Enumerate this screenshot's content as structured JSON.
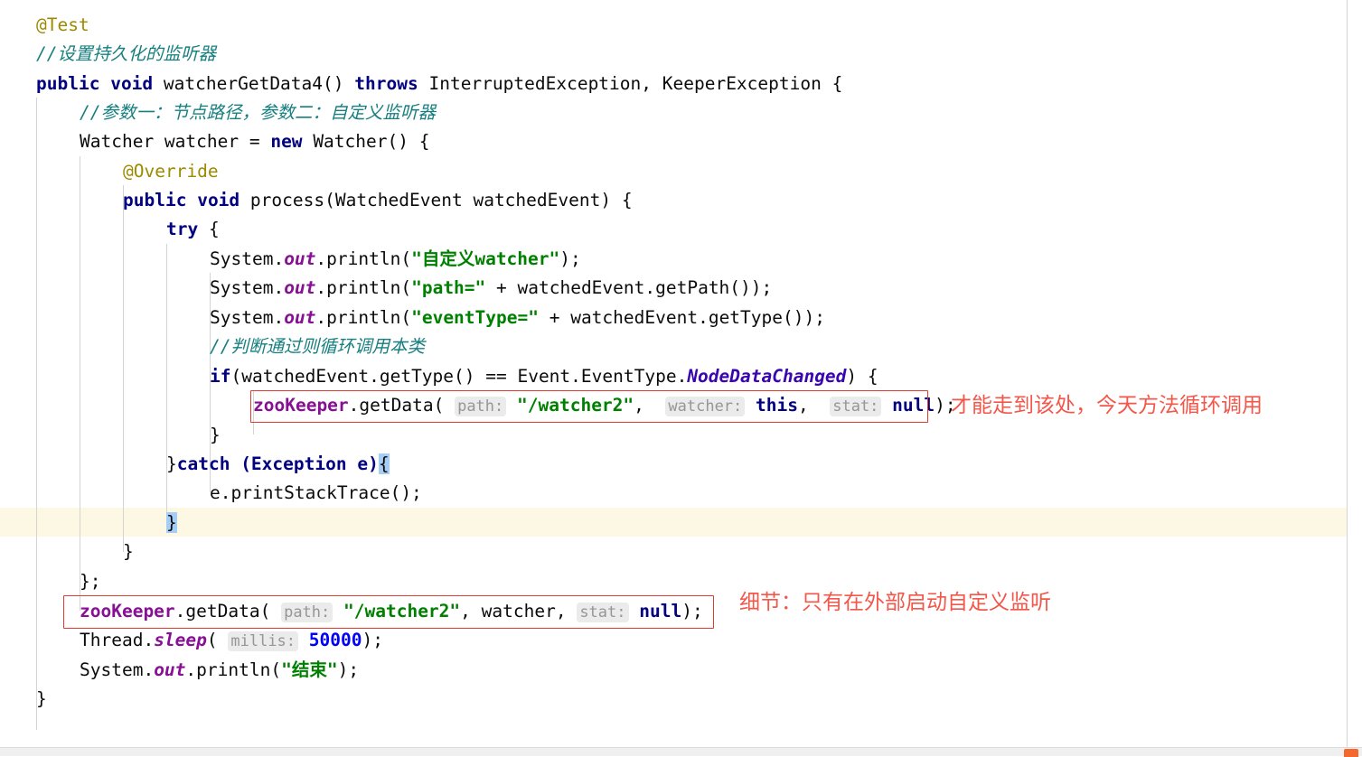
{
  "editor": {
    "language": "Java",
    "font_size_px": 19.5,
    "line_height_px": 32,
    "colors": {
      "background": "#ffffff",
      "text": "#0b0b0b",
      "keyword": "#000080",
      "annotation": "#9e8a00",
      "comment": "#177f7f",
      "string": "#008000",
      "number": "#0000ff",
      "static_field": "#871094",
      "enum_constant": "#3a04b0",
      "param_hint_bg": "#ebebeb",
      "param_hint_text": "#969696",
      "brace_match_highlight": "#a5cdf5",
      "caret_row": "#fdf8e3",
      "callout_border": "#e03c31",
      "annotation_red": "#f4564a",
      "indent_guide": "#d4d4d4",
      "status_marker": "#f4682e"
    }
  },
  "code": {
    "lines": [
      {
        "id": "l1",
        "indent": 0,
        "text": "@Test"
      },
      {
        "id": "l2",
        "indent": 0,
        "text": "//设置持久化的监听器"
      },
      {
        "id": "l3",
        "indent": 0,
        "text": "public void watcherGetData4() throws InterruptedException, KeeperException {"
      },
      {
        "id": "l4",
        "indent": 1,
        "text": "//参数一：节点路径，参数二：自定义监听器"
      },
      {
        "id": "l5",
        "indent": 1,
        "text": "Watcher watcher = new Watcher() {"
      },
      {
        "id": "l6",
        "indent": 2,
        "text": "@Override"
      },
      {
        "id": "l7",
        "indent": 2,
        "text": "public void process(WatchedEvent watchedEvent) {"
      },
      {
        "id": "l8",
        "indent": 3,
        "text": "try {"
      },
      {
        "id": "l9",
        "indent": 4,
        "text": "System.out.println(\"自定义watcher\");"
      },
      {
        "id": "l10",
        "indent": 4,
        "text": "System.out.println(\"path=\" + watchedEvent.getPath());"
      },
      {
        "id": "l11",
        "indent": 4,
        "text": "System.out.println(\"eventType=\" + watchedEvent.getType());"
      },
      {
        "id": "l12",
        "indent": 4,
        "text": "//判断通过则循环调用本类"
      },
      {
        "id": "l13",
        "indent": 4,
        "text": "if(watchedEvent.getType() == Event.EventType.NodeDataChanged) {"
      },
      {
        "id": "l14",
        "indent": 5,
        "text": "zooKeeper.getData( path: \"/watcher2\",  watcher: this,  stat: null);"
      },
      {
        "id": "l15",
        "indent": 4,
        "text": "}"
      },
      {
        "id": "l16",
        "indent": 3,
        "text": "}catch (Exception e){"
      },
      {
        "id": "l17",
        "indent": 4,
        "text": "e.printStackTrace();"
      },
      {
        "id": "l18",
        "indent": 3,
        "text": "}"
      },
      {
        "id": "l19",
        "indent": 2,
        "text": "}"
      },
      {
        "id": "l20",
        "indent": 1,
        "text": "};"
      },
      {
        "id": "l21",
        "indent": 1,
        "text": "zooKeeper.getData( path: \"/watcher2\", watcher,  stat: null);"
      },
      {
        "id": "l22",
        "indent": 1,
        "text": "Thread.sleep( millis: 50000);"
      },
      {
        "id": "l23",
        "indent": 1,
        "text": "System.out.println(\"结束\");"
      },
      {
        "id": "l24",
        "indent": 0,
        "text": "}"
      }
    ],
    "tokens": {
      "at_test": "@Test",
      "comment_persistent_watcher": "//设置持久化的监听器",
      "kw_public": "public",
      "kw_void": "void",
      "kw_throws": "throws",
      "kw_new": "new",
      "kw_try": "try",
      "kw_catch": "catch",
      "kw_if": "if",
      "kw_this": "this",
      "kw_null": "null",
      "method_name": "watcherGetData4()",
      "exceptions": "InterruptedException, KeeperException {",
      "comment_params": "//参数一：节点路径，参数二：自定义监听器",
      "decl_watcher": "Watcher watcher = ",
      "ctor_watcher": "Watcher() {",
      "at_override": "@Override",
      "process_sig": "process(WatchedEvent watchedEvent) {",
      "system": "System.",
      "out": "out",
      "println": ".println(",
      "str_custom_watcher": "\"自定义watcher\"",
      "str_path_eq": "\"path=\"",
      "str_event_type_eq": "\"eventType=\"",
      "get_path_call": " + watchedEvent.getPath());",
      "get_type_call": " + watchedEvent.getType());",
      "comment_loop_call": "//判断通过则循环调用本类",
      "if_condition": "(watchedEvent.getType() == Event.EventType.",
      "enum_node_data_changed": "NodeDataChanged",
      "if_tail": ") {",
      "zookeeper": "zooKeeper",
      "get_data": ".getData( ",
      "hint_path": "path:",
      "str_watcher2": "\"/watcher2\"",
      "hint_watcher": "watcher:",
      "hint_stat": "stat:",
      "catch_clause": "catch (Exception e)",
      "brace_open": "{",
      "brace_close": "}",
      "print_stack_trace": "e.printStackTrace();",
      "close_anon": "};",
      "arg_watcher": "watcher,",
      "thread_sleep": "Thread.",
      "sleep": "sleep",
      "hint_millis": "millis:",
      "num_50000": "50000",
      "str_end": "\"结束\""
    }
  },
  "callouts": [
    {
      "id": "box-inner-getdata",
      "target": "l14"
    },
    {
      "id": "box-outer-getdata",
      "target": "l21"
    }
  ],
  "annotations": [
    {
      "id": "note-top",
      "text": "才能走到该处，今天方法循环调用"
    },
    {
      "id": "note-bottom",
      "text": "细节：只有在外部启动自定义监听"
    }
  ],
  "statusbar": {
    "marker": "orange-marker"
  }
}
